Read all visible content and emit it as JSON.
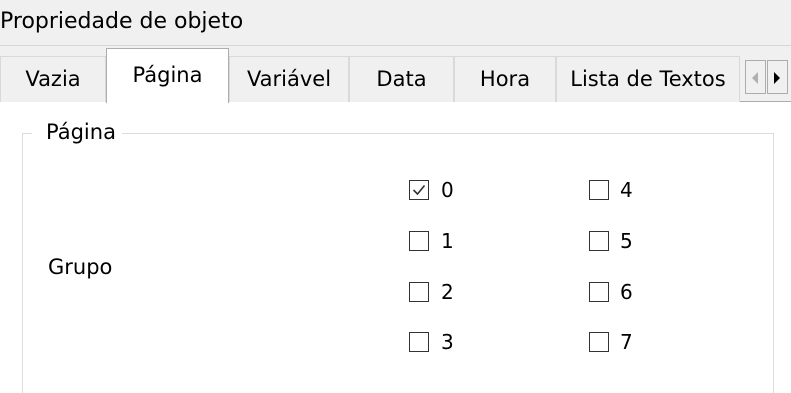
{
  "window": {
    "title": "Propriedade de objeto"
  },
  "tabs": [
    {
      "label": "Vazia",
      "active": false
    },
    {
      "label": "Página",
      "active": true
    },
    {
      "label": "Variável",
      "active": false
    },
    {
      "label": "Data",
      "active": false
    },
    {
      "label": "Hora",
      "active": false
    },
    {
      "label": "Lista de Textos",
      "active": false
    }
  ],
  "tab_scroll": {
    "left_icon": "arrow-left-icon",
    "right_icon": "arrow-right-icon"
  },
  "groupbox": {
    "title": "Página"
  },
  "grupo": {
    "label": "Grupo",
    "checkboxes": [
      {
        "label": "0",
        "checked": true
      },
      {
        "label": "1",
        "checked": false
      },
      {
        "label": "2",
        "checked": false
      },
      {
        "label": "3",
        "checked": false
      },
      {
        "label": "4",
        "checked": false
      },
      {
        "label": "5",
        "checked": false
      },
      {
        "label": "6",
        "checked": false
      },
      {
        "label": "7",
        "checked": false
      }
    ]
  }
}
